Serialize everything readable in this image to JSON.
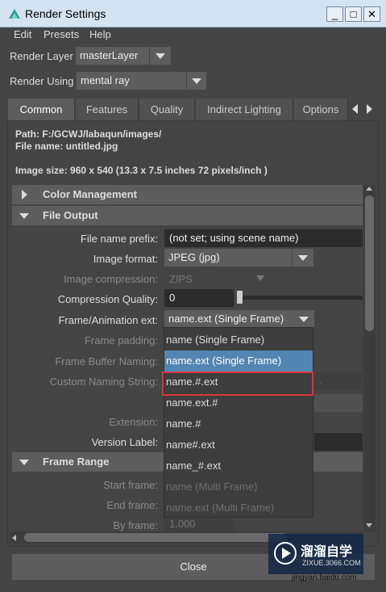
{
  "window": {
    "title": "Render Settings",
    "minimize": "_",
    "maximize": "□",
    "close": "✕"
  },
  "menu": [
    "Edit",
    "Presets",
    "Help"
  ],
  "render_layer": {
    "label": "Render Layer",
    "value": "masterLayer"
  },
  "render_using": {
    "label": "Render Using",
    "value": "mental ray"
  },
  "tabs": [
    "Common",
    "Features",
    "Quality",
    "Indirect Lighting",
    "Options"
  ],
  "info": {
    "path": "Path: F:/GCWJ/labaqun/images/",
    "file_name": "File name:  untitled.jpg",
    "image_size": "Image size: 960 x 540 (13.3 x 7.5 inches 72 pixels/inch )"
  },
  "sections": {
    "color_management": "Color Management",
    "file_output": "File Output",
    "frame_range": "Frame Range"
  },
  "fields": {
    "file_name_prefix": {
      "label": "File name prefix:",
      "value": "(not set; using scene name)"
    },
    "image_format": {
      "label": "Image format:",
      "value": "JPEG (jpg)"
    },
    "image_compression": {
      "label": "Image compression:",
      "value": "ZIPS"
    },
    "compression_quality": {
      "label": "Compression Quality:",
      "value": "0"
    },
    "frame_animation_ext": {
      "label": "Frame/Animation ext:",
      "value": "name.ext (Single Frame)"
    },
    "frame_padding": {
      "label": "Frame padding:"
    },
    "frame_buffer_naming": {
      "label": "Frame Buffer Naming:"
    },
    "custom_naming_string": {
      "label": "Custom Naming String:",
      "value": ".<Camera"
    },
    "extension": {
      "label": "Extension:"
    },
    "version_label": {
      "label": "Version Label:"
    },
    "start_frame": {
      "label": "Start frame:"
    },
    "end_frame": {
      "label": "End frame:"
    },
    "by_frame": {
      "label": "By frame:",
      "value": "1.000"
    }
  },
  "dropdown_options": [
    "name (Single Frame)",
    "name.ext (Single Frame)",
    "name.#.ext",
    "name.ext.#",
    "name.#",
    "name#.ext",
    "name_#.ext",
    "name (Multi Frame)",
    "name.ext (Multi Frame)"
  ],
  "close_button": "Close",
  "watermark": {
    "title": "溜溜自学",
    "sub": "ZIXUE.3066.COM",
    "url": "jingyan.baidu.com"
  },
  "colors": {
    "selected": "#5285b2",
    "highlight_box": "#d9363e",
    "background": "#444444"
  }
}
